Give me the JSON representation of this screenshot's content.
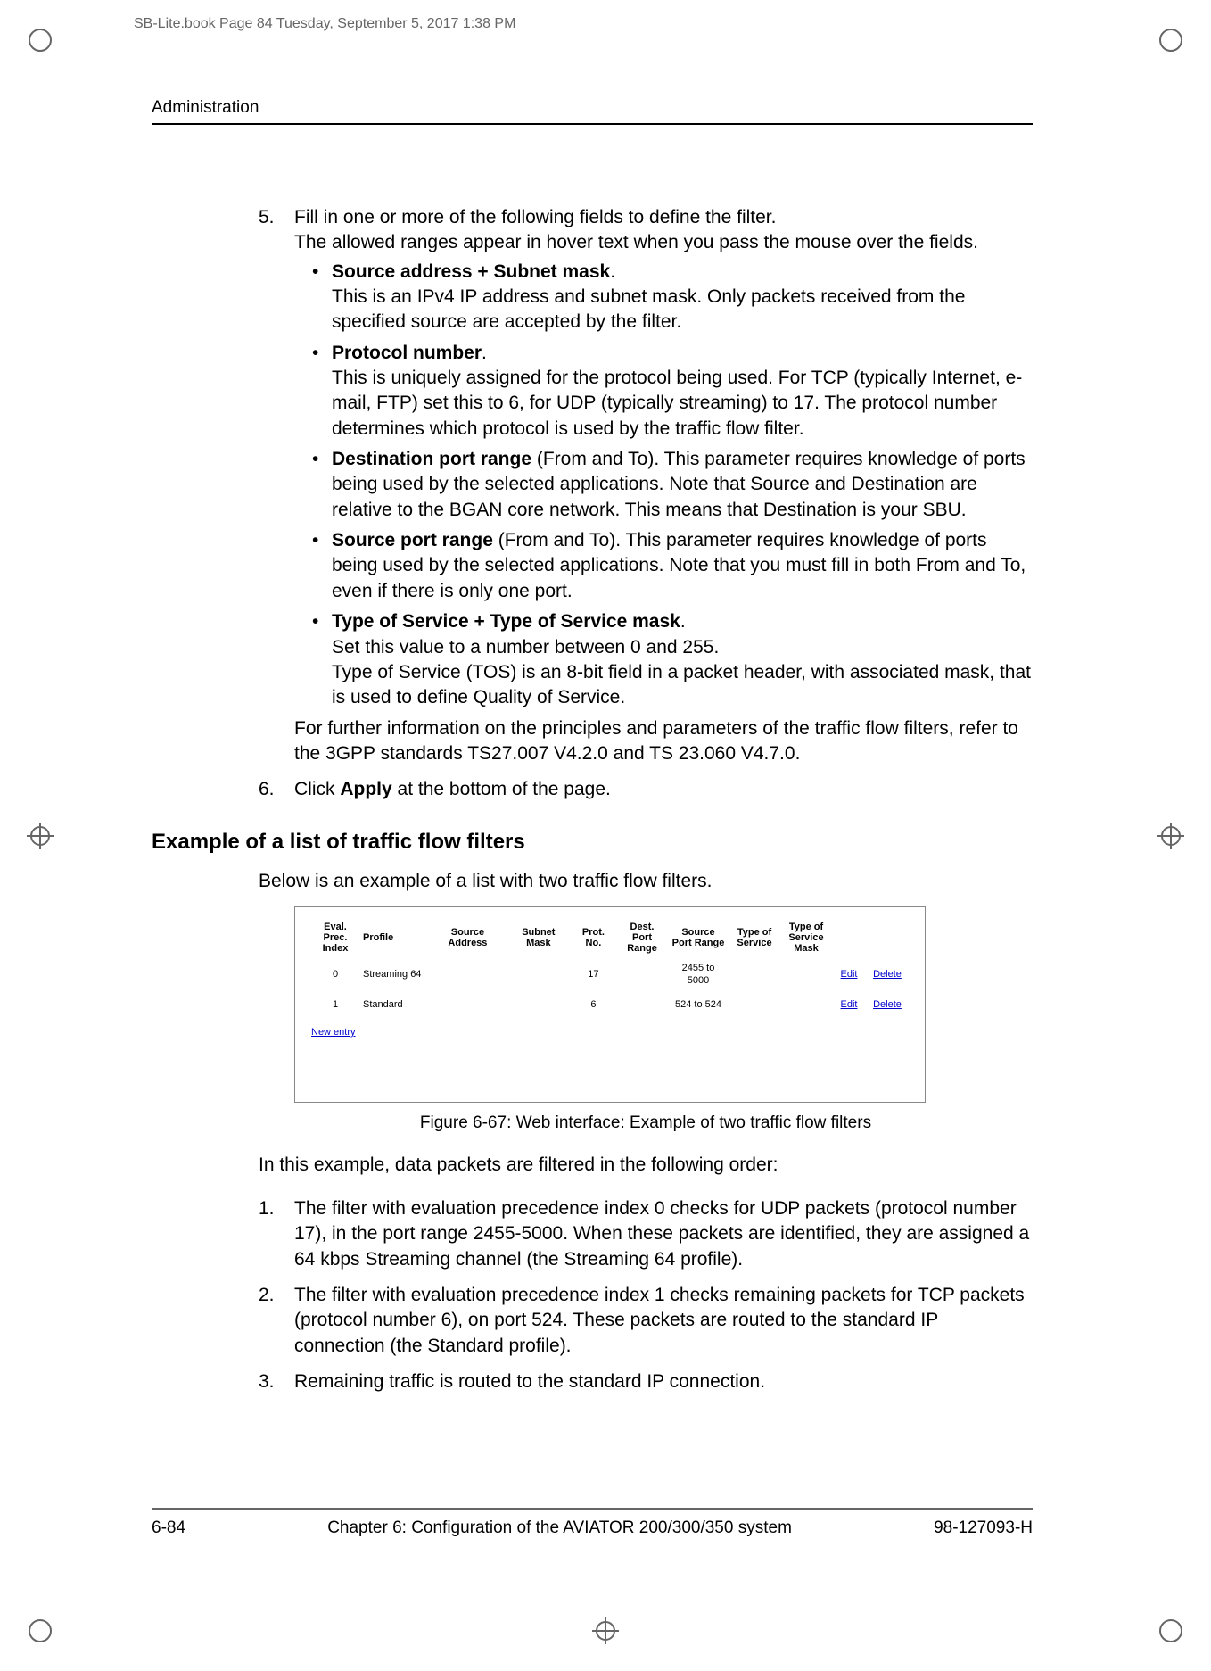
{
  "page_meta": "SB-Lite.book  Page 84  Tuesday, September 5, 2017  1:38 PM",
  "running_head": "Administration",
  "step5": {
    "num": "5.",
    "intro_l1": "Fill in one or more of the following fields to define the filter.",
    "intro_l2": "The allowed ranges appear in hover text when you pass the mouse over the fields.",
    "b1_head": "Source address + Subnet mask",
    "b1_tail": ".",
    "b1_body": "This is an IPv4 IP address and subnet mask. Only packets received from the specified source are accepted by the filter.",
    "b2_head": "Protocol number",
    "b2_tail": ".",
    "b2_body": "This is uniquely assigned for the protocol being used. For TCP (typically Internet, e-mail, FTP) set this to 6, for UDP (typically streaming) to 17. The protocol number determines which protocol is used by the traffic flow filter.",
    "b3_head": "Destination port range",
    "b3_tail": " (From and To). This parameter requires knowledge of ports being used by the selected applications. Note that Source and Destination are relative to the BGAN core network. This means that Destination is your SBU.",
    "b4_head": "Source port range",
    "b4_tail": " (From and To). This parameter requires knowledge of ports being used by the selected applications. Note that you must fill in both From and To, even if there is only one port.",
    "b5_head": "Type of Service + Type of Service mask",
    "b5_tail": ".",
    "b5_body_l1": "Set this value to a number between 0 and 255.",
    "b5_body_l2": "Type of Service (TOS) is an 8-bit field in a packet header, with associated mask, that is used to define Quality of Service.",
    "outro": "For further information on the principles and parameters of the traffic flow filters, refer to the 3GPP standards TS27.007 V4.2.0 and TS 23.060 V4.7.0."
  },
  "step6": {
    "num": "6.",
    "pre": "Click ",
    "bold": "Apply",
    "post": " at the bottom of the page."
  },
  "section_h": "Example of a list of traffic flow filters",
  "example_intro": "Below is an example of a list with two traffic flow filters.",
  "fig": {
    "headers": {
      "c1": "Eval. Prec. Index",
      "c2": "Profile",
      "c3": "Source Address",
      "c4": "Subnet Mask",
      "c5": "Prot. No.",
      "c6": "Dest. Port Range",
      "c7": "Source Port Range",
      "c8": "Type of Service",
      "c9": "Type of Service Mask"
    },
    "rows": [
      {
        "idx": "0",
        "profile": "Streaming 64",
        "src": "",
        "mask": "",
        "prot": "17",
        "dport": "",
        "sport": "2455 to 5000",
        "tos": "",
        "tosm": "",
        "edit": "Edit",
        "del": "Delete"
      },
      {
        "idx": "1",
        "profile": "Standard",
        "src": "",
        "mask": "",
        "prot": "6",
        "dport": "",
        "sport": "524 to 524",
        "tos": "",
        "tosm": "",
        "edit": "Edit",
        "del": "Delete"
      }
    ],
    "new_entry": "New entry"
  },
  "fig_caption": "Figure 6-67: Web interface: Example of two traffic flow filters",
  "example_after": "In this example, data packets are filtered in the following order:",
  "ordered": {
    "i1n": "1.",
    "i1": "The filter with evaluation precedence index 0 checks for UDP packets (protocol number 17), in the port range 2455-5000. When these packets are identified, they are assigned a 64 kbps Streaming channel (the Streaming 64 profile).",
    "i2n": "2.",
    "i2": "The filter with evaluation precedence index 1 checks remaining packets for TCP packets (protocol number 6), on port 524. These packets are routed to the standard IP connection (the Standard profile).",
    "i3n": "3.",
    "i3": "Remaining traffic is routed to the standard IP connection."
  },
  "footer": {
    "left": "6-84",
    "center": "Chapter 6:  Configuration of the AVIATOR 200/300/350 system",
    "right": "98-127093-H"
  }
}
